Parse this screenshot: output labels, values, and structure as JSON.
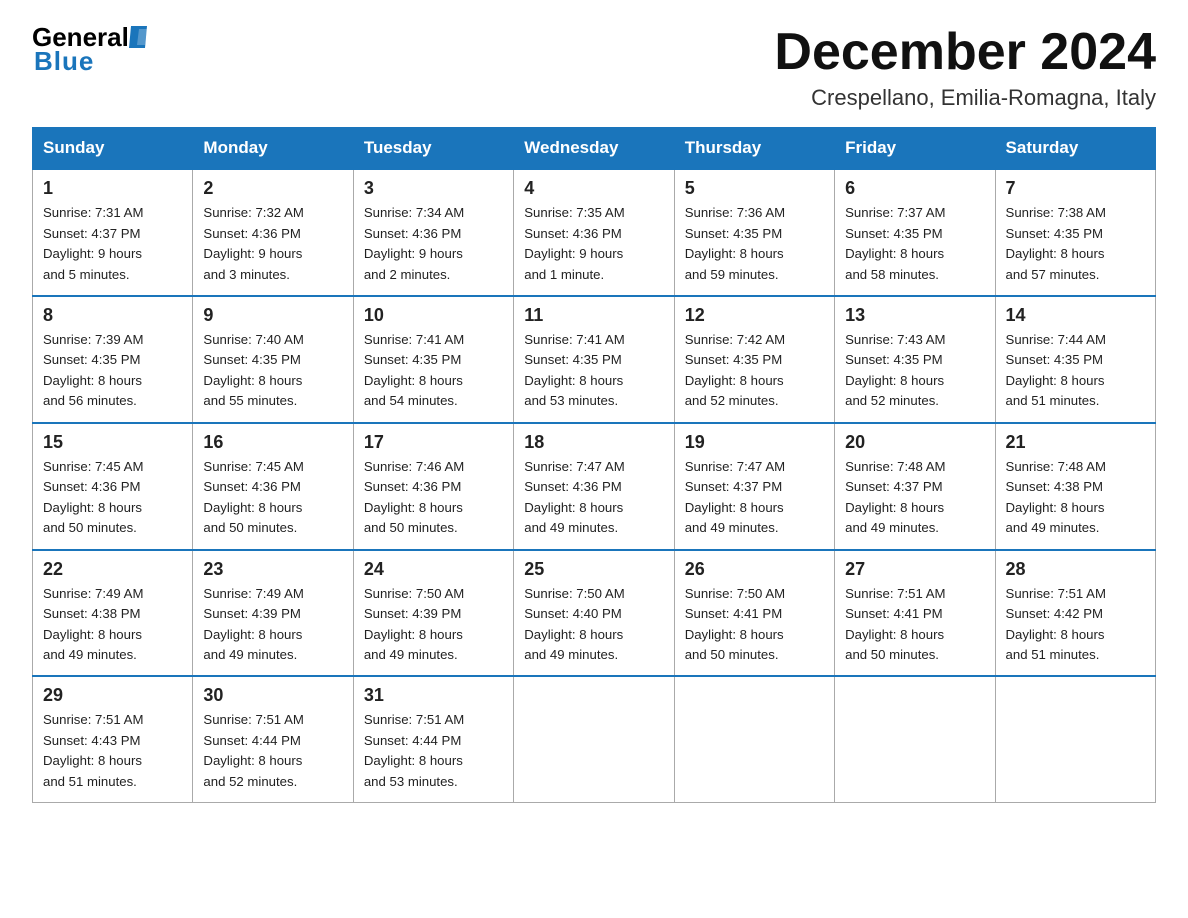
{
  "header": {
    "logo_general": "General",
    "logo_blue": "Blue",
    "month_title": "December 2024",
    "location": "Crespellano, Emilia-Romagna, Italy"
  },
  "days_of_week": [
    "Sunday",
    "Monday",
    "Tuesday",
    "Wednesday",
    "Thursday",
    "Friday",
    "Saturday"
  ],
  "weeks": [
    [
      {
        "day": "1",
        "sunrise": "7:31 AM",
        "sunset": "4:37 PM",
        "daylight": "9 hours and 5 minutes."
      },
      {
        "day": "2",
        "sunrise": "7:32 AM",
        "sunset": "4:36 PM",
        "daylight": "9 hours and 3 minutes."
      },
      {
        "day": "3",
        "sunrise": "7:34 AM",
        "sunset": "4:36 PM",
        "daylight": "9 hours and 2 minutes."
      },
      {
        "day": "4",
        "sunrise": "7:35 AM",
        "sunset": "4:36 PM",
        "daylight": "9 hours and 1 minute."
      },
      {
        "day": "5",
        "sunrise": "7:36 AM",
        "sunset": "4:35 PM",
        "daylight": "8 hours and 59 minutes."
      },
      {
        "day": "6",
        "sunrise": "7:37 AM",
        "sunset": "4:35 PM",
        "daylight": "8 hours and 58 minutes."
      },
      {
        "day": "7",
        "sunrise": "7:38 AM",
        "sunset": "4:35 PM",
        "daylight": "8 hours and 57 minutes."
      }
    ],
    [
      {
        "day": "8",
        "sunrise": "7:39 AM",
        "sunset": "4:35 PM",
        "daylight": "8 hours and 56 minutes."
      },
      {
        "day": "9",
        "sunrise": "7:40 AM",
        "sunset": "4:35 PM",
        "daylight": "8 hours and 55 minutes."
      },
      {
        "day": "10",
        "sunrise": "7:41 AM",
        "sunset": "4:35 PM",
        "daylight": "8 hours and 54 minutes."
      },
      {
        "day": "11",
        "sunrise": "7:41 AM",
        "sunset": "4:35 PM",
        "daylight": "8 hours and 53 minutes."
      },
      {
        "day": "12",
        "sunrise": "7:42 AM",
        "sunset": "4:35 PM",
        "daylight": "8 hours and 52 minutes."
      },
      {
        "day": "13",
        "sunrise": "7:43 AM",
        "sunset": "4:35 PM",
        "daylight": "8 hours and 52 minutes."
      },
      {
        "day": "14",
        "sunrise": "7:44 AM",
        "sunset": "4:35 PM",
        "daylight": "8 hours and 51 minutes."
      }
    ],
    [
      {
        "day": "15",
        "sunrise": "7:45 AM",
        "sunset": "4:36 PM",
        "daylight": "8 hours and 50 minutes."
      },
      {
        "day": "16",
        "sunrise": "7:45 AM",
        "sunset": "4:36 PM",
        "daylight": "8 hours and 50 minutes."
      },
      {
        "day": "17",
        "sunrise": "7:46 AM",
        "sunset": "4:36 PM",
        "daylight": "8 hours and 50 minutes."
      },
      {
        "day": "18",
        "sunrise": "7:47 AM",
        "sunset": "4:36 PM",
        "daylight": "8 hours and 49 minutes."
      },
      {
        "day": "19",
        "sunrise": "7:47 AM",
        "sunset": "4:37 PM",
        "daylight": "8 hours and 49 minutes."
      },
      {
        "day": "20",
        "sunrise": "7:48 AM",
        "sunset": "4:37 PM",
        "daylight": "8 hours and 49 minutes."
      },
      {
        "day": "21",
        "sunrise": "7:48 AM",
        "sunset": "4:38 PM",
        "daylight": "8 hours and 49 minutes."
      }
    ],
    [
      {
        "day": "22",
        "sunrise": "7:49 AM",
        "sunset": "4:38 PM",
        "daylight": "8 hours and 49 minutes."
      },
      {
        "day": "23",
        "sunrise": "7:49 AM",
        "sunset": "4:39 PM",
        "daylight": "8 hours and 49 minutes."
      },
      {
        "day": "24",
        "sunrise": "7:50 AM",
        "sunset": "4:39 PM",
        "daylight": "8 hours and 49 minutes."
      },
      {
        "day": "25",
        "sunrise": "7:50 AM",
        "sunset": "4:40 PM",
        "daylight": "8 hours and 49 minutes."
      },
      {
        "day": "26",
        "sunrise": "7:50 AM",
        "sunset": "4:41 PM",
        "daylight": "8 hours and 50 minutes."
      },
      {
        "day": "27",
        "sunrise": "7:51 AM",
        "sunset": "4:41 PM",
        "daylight": "8 hours and 50 minutes."
      },
      {
        "day": "28",
        "sunrise": "7:51 AM",
        "sunset": "4:42 PM",
        "daylight": "8 hours and 51 minutes."
      }
    ],
    [
      {
        "day": "29",
        "sunrise": "7:51 AM",
        "sunset": "4:43 PM",
        "daylight": "8 hours and 51 minutes."
      },
      {
        "day": "30",
        "sunrise": "7:51 AM",
        "sunset": "4:44 PM",
        "daylight": "8 hours and 52 minutes."
      },
      {
        "day": "31",
        "sunrise": "7:51 AM",
        "sunset": "4:44 PM",
        "daylight": "8 hours and 53 minutes."
      },
      null,
      null,
      null,
      null
    ]
  ],
  "labels": {
    "sunrise": "Sunrise:",
    "sunset": "Sunset:",
    "daylight": "Daylight:"
  }
}
